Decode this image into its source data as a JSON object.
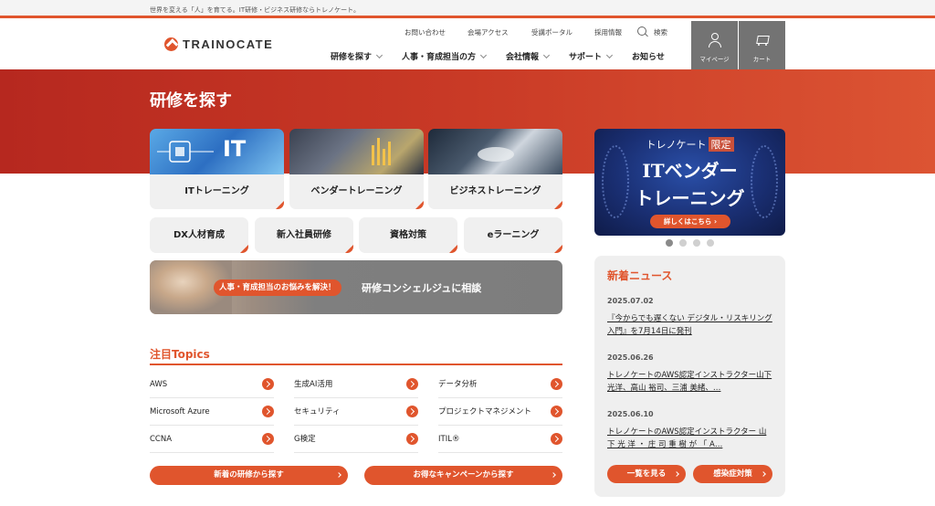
{
  "topbar": {
    "tagline": "世界を変える「人」を育てる。IT研修・ビジネス研修ならトレノケート。"
  },
  "header": {
    "logo_text": "TRAINOCATE",
    "util_links": [
      "お問い合わせ",
      "会場アクセス",
      "受講ポータル",
      "採用情報"
    ],
    "search_label": "検索",
    "nav": [
      "研修を探す",
      "人事・育成担当の方",
      "会社情報",
      "サポート",
      "お知らせ"
    ],
    "mypage_label": "マイページ",
    "cart_label": "カート"
  },
  "hero": {
    "title": "研修を探す"
  },
  "cards": [
    "ITトレーニング",
    "ベンダートレーニング",
    "ビジネストレーニング"
  ],
  "card_img_text": "IT",
  "tiles": [
    "DX人材育成",
    "新入社員研修",
    "資格対策",
    "eラーニング"
  ],
  "consult": {
    "badge": "人事・育成担当のお悩みを解決！",
    "text": "研修コンシェルジュに相談"
  },
  "topics": {
    "title": "注目Topics",
    "items": [
      "AWS",
      "生成AI活用",
      "データ分析",
      "Microsoft Azure",
      "セキュリティ",
      "プロジェクトマネジメント",
      "CCNA",
      "G検定",
      "ITIL®"
    ]
  },
  "buttons": {
    "new_courses": "新着の研修から探す",
    "campaign": "お得なキャンペーンから探す"
  },
  "banner": {
    "line1": "トレノケート",
    "line1_accent": "限定",
    "line2": "ITベンダー",
    "line3": "トレーニング",
    "button": "詳しくはこちら ›"
  },
  "news": {
    "title": "新着ニュース",
    "items": [
      {
        "date": "2025.07.02",
        "text": "『今からでも遅くない デジタル・リスキリング入門』を7月14日に発刊"
      },
      {
        "date": "2025.06.26",
        "text": "トレノケートのAWS認定インストラクター山下 光洋、高山 裕司、三浦 美緒、…"
      },
      {
        "date": "2025.06.10",
        "text": "トレノケートのAWS認定インストラクター 山 下 光 洋 ・ 庄 司 重 樹 が 「 A…"
      }
    ],
    "list_button": "一覧を見る",
    "infection_button": "感染症対策"
  },
  "colors": {
    "accent": "#e0552d",
    "hero": "#c93a26",
    "header_button": "#737373"
  }
}
